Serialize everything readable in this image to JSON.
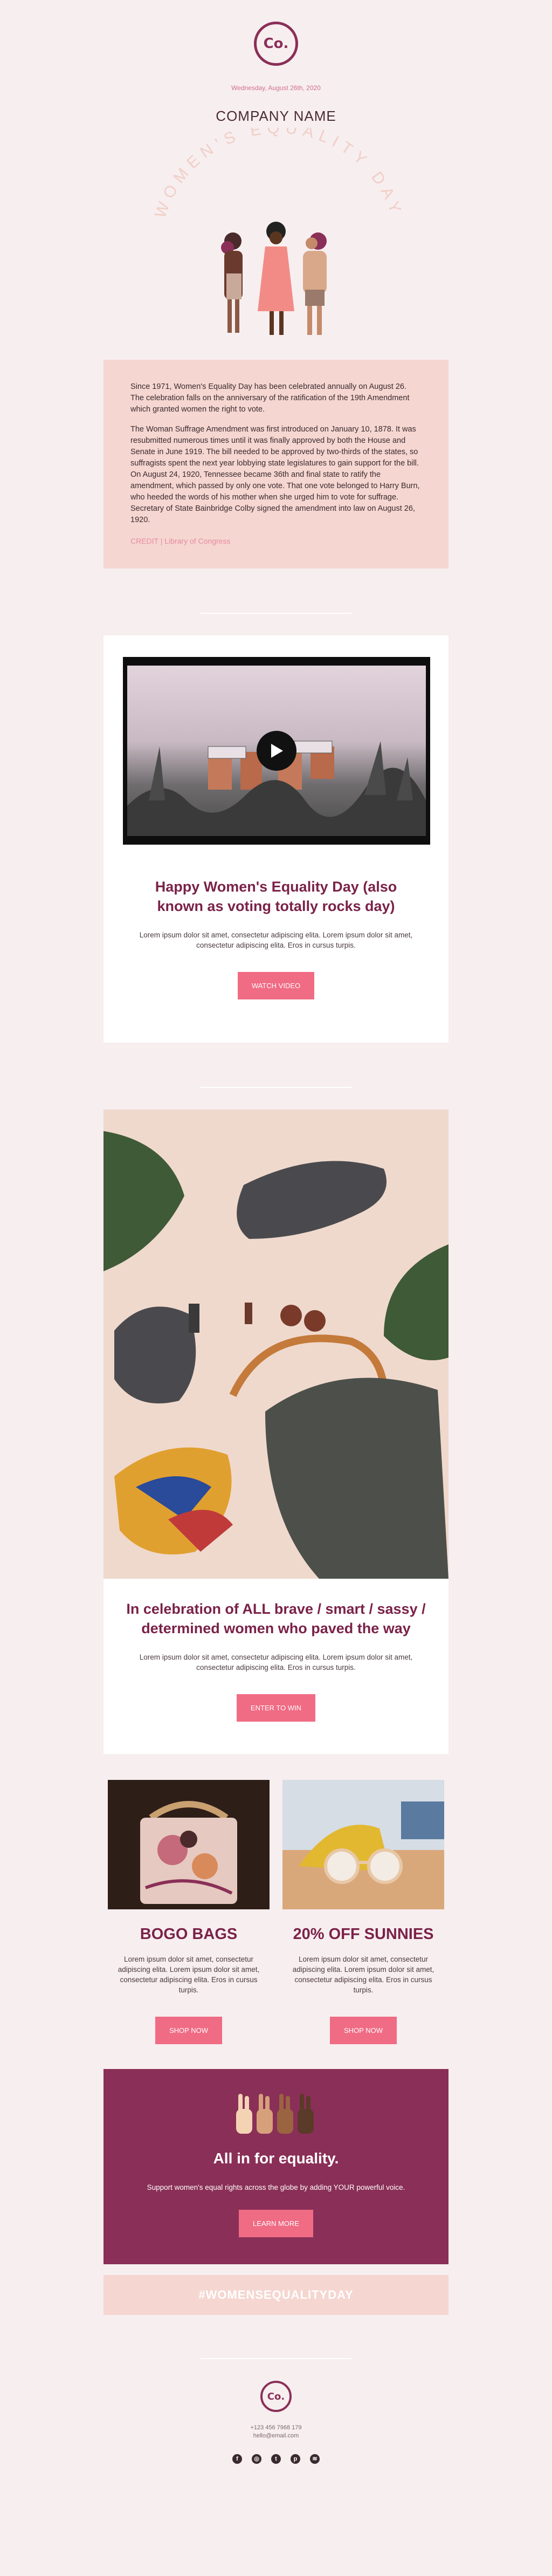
{
  "header": {
    "logo_text": "Co.",
    "date": "Wednesday, August 26th, 2020",
    "company": "COMPANY NAME",
    "arc_heading": "WOMEN'S EQUALITY DAY"
  },
  "story": {
    "paragraphs": [
      "Since 1971, Women's Equality Day has been celebrated annually on August 26. The celebration falls on the anniversary of the ratification of the 19th Amendment which granted women the right to vote.",
      "The Woman Suffrage Amendment was first introduced on January 10, 1878. It was resubmitted numerous times until it was finally approved by both the House and Senate in June 1919. The bill needed to be approved by two-thirds of the states, so suffragists spent the next year lobbying state legislatures to gain support for the bill. On August 24, 1920, Tennessee became 36th and final state to ratify the amendment, which passed by only one vote. That one vote belonged to Harry Burn, who heeded the words of his mother when she urged him to vote for suffrage. Secretary of State Bainbridge Colby signed the amendment into law on August 26, 1920."
    ],
    "credit": "CREDIT | Library of Congress"
  },
  "video_card": {
    "title": "Happy Women's Equality Day (also known as voting totally rocks day)",
    "body": "Lorem ipsum dolor sit amet, consectetur adipiscing elita. Lorem ipsum dolor sit amet, consectetur adipiscing elita. Eros in cursus turpis.",
    "button": "WATCH VIDEO"
  },
  "photo_card": {
    "title": "In celebration of ALL brave / smart / sassy / determined women who paved the way",
    "body": "Lorem ipsum dolor sit amet, consectetur adipiscing elita. Lorem ipsum dolor sit amet, consectetur adipiscing elita. Eros in cursus turpis.",
    "button": "ENTER TO WIN"
  },
  "columns": [
    {
      "title": "BOGO BAGS",
      "body": "Lorem ipsum dolor sit amet, consectetur adipiscing elita. Lorem ipsum dolor sit amet, consectetur adipiscing elita. Eros in cursus turpis.",
      "button": "SHOP NOW"
    },
    {
      "title": "20% OFF SUNNIES",
      "body": "Lorem ipsum dolor sit amet, consectetur adipiscing elita. Lorem ipsum dolor sit amet, consectetur adipiscing elita. Eros in cursus turpis.",
      "button": "SHOP NOW"
    }
  ],
  "equality": {
    "title": "All in for equality.",
    "body": "Support women's equal rights across the globe by adding YOUR powerful voice.",
    "button": "LEARN MORE"
  },
  "hashtag": "#WOMENSEQUALITYDAY",
  "footer": {
    "logo_text": "Co.",
    "phone": "+123 456 7968 179",
    "email": "hello@email.com",
    "socials": [
      "facebook-icon",
      "instagram-icon",
      "twitter-icon",
      "pinterest-icon",
      "spotify-icon"
    ]
  },
  "colors": {
    "brand": "#8a2f57",
    "accent": "#f06b84",
    "blush": "#f5d6d0",
    "background": "#f7eeef"
  }
}
